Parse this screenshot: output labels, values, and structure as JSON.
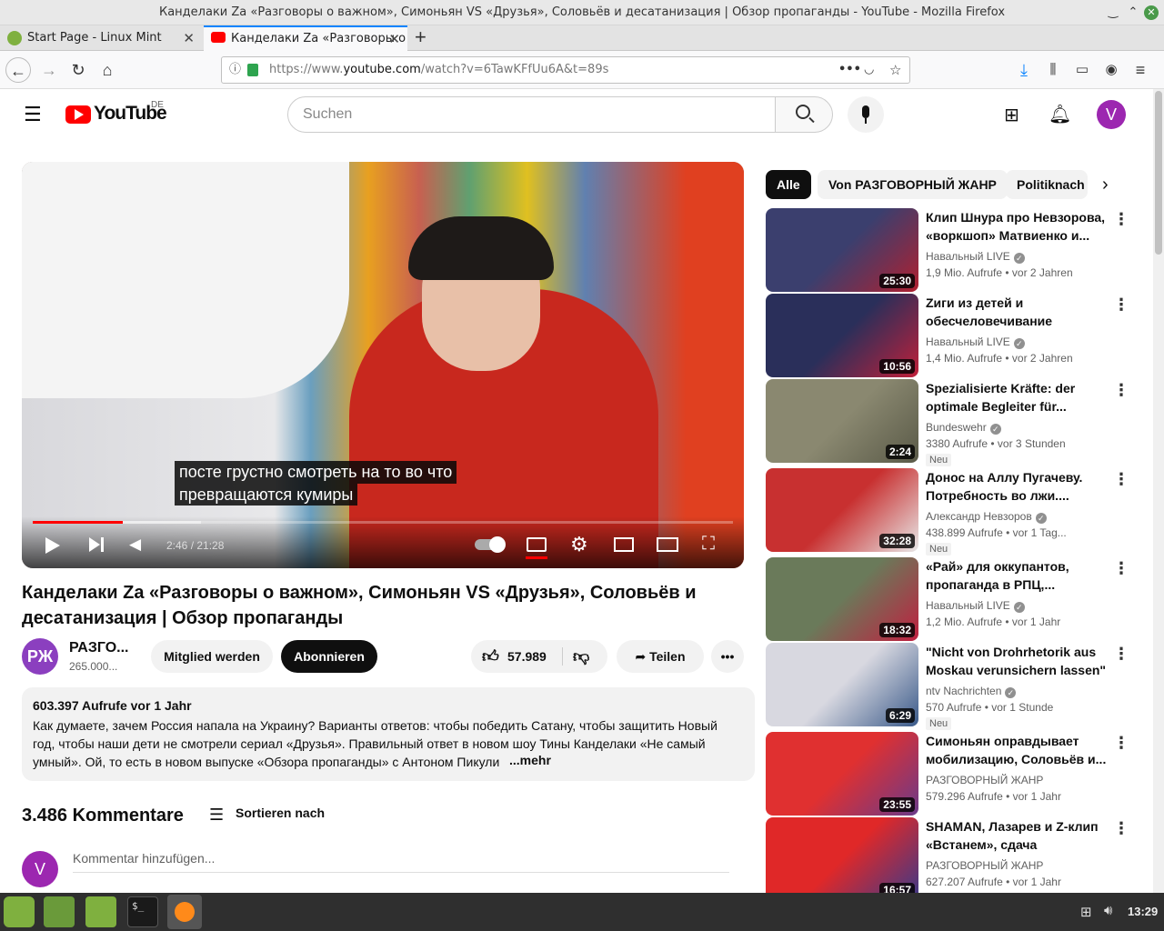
{
  "window": {
    "title": "Канделаки Za «Разговоры о важном», Симоньян VS «Друзья», Соловьёв и десатанизация | Обзор пропаганды - YouTube - Mozilla Firefox"
  },
  "tabs": [
    {
      "label": "Start Page - Linux Mint"
    },
    {
      "label": "Канделаки Za «Разговоры о"
    }
  ],
  "url": {
    "prefix": "https://www.",
    "domain": "youtube.com",
    "path": "/watch?v=6TawKFfUu6A&t=89s"
  },
  "yt": {
    "logo": "YouTube",
    "region": "DE",
    "search_placeholder": "Suchen",
    "avatar_letter": "V"
  },
  "video": {
    "subtitle_line1": "посте грустно смотреть на то во что",
    "subtitle_line2": "превращаются кумиры",
    "time": "2:46 / 21:28",
    "progress": 0.129,
    "buffered": 0.24,
    "title": "Канделаки Za «Разговоры о важном», Симоньян VS «Друзья», Соловьёв и десатанизация | Обзор пропаганды",
    "channel": "РАЗГО...",
    "subs": "265.000...",
    "join": "Mitglied werden",
    "subscribe": "Abonnieren",
    "likes": "57.989",
    "share": "Teilen",
    "views": "603.397 Aufrufe  vor 1 Jahr",
    "description": "Как думаете, зачем Россия напала на Украину? Варианты ответов: чтобы победить Сатану, чтобы защитить Новый год, чтобы наши дети не смотрели сериал «Друзья». Правильный ответ в новом шоу Тины Канделаки «Не самый умный». Ой, то есть в новом выпуске «Обзора пропаганды» с Антоном Пикули",
    "more": "...mehr"
  },
  "comments": {
    "count": "3.486 Kommentare",
    "sort": "Sortieren nach",
    "placeholder": "Kommentar hinzufügen..."
  },
  "chips": [
    "Alle",
    "Von РАЗГОВОРНЫЙ ЖАНР",
    "Politiknach"
  ],
  "recommendations": [
    {
      "title": "Клип Шнура про Невзорова, «воркшоп» Матвиенко и...",
      "channel": "Навальный LIVE",
      "verified": true,
      "meta": "1,9 Mio. Aufrufe  • vor 2 Jahren",
      "duration": "25:30",
      "badge": "",
      "colors": [
        "#3b3f6e",
        "#b02030"
      ]
    },
    {
      "title": "Zиги из детей и обесчеловечивание Украин...",
      "channel": "Навальный LIVE",
      "verified": true,
      "meta": "1,4 Mio. Aufrufe  • vor 2 Jahren",
      "duration": "10:56",
      "badge": "",
      "colors": [
        "#2a2f5a",
        "#c0203a"
      ]
    },
    {
      "title": "Spezialisierte Kräfte: der optimale Begleiter für...",
      "channel": "Bundeswehr",
      "verified": true,
      "meta": "3380 Aufrufe  • vor 3 Stunden",
      "duration": "2:24",
      "badge": "Neu",
      "colors": [
        "#8a8870",
        "#5a5a48"
      ]
    },
    {
      "title": "Донос на Аллу Пугачеву. Потребность во лжи....",
      "channel": "Александр Невзоров",
      "verified": true,
      "meta": "438.899 Aufrufe  • vor 1 Tag...",
      "duration": "32:28",
      "badge": "Neu",
      "colors": [
        "#c83030",
        "#e8e8e8"
      ]
    },
    {
      "title": "«Рай» для оккупантов, пропаганда в РПЦ,...",
      "channel": "Навальный LIVE",
      "verified": true,
      "meta": "1,2 Mio. Aufrufe  • vor 1 Jahr",
      "duration": "18:32",
      "badge": "",
      "colors": [
        "#6a7a5a",
        "#c02040"
      ]
    },
    {
      "title": "\"Nicht von Drohrhetorik aus Moskau verunsichern lassen\" ...",
      "channel": "ntv Nachrichten",
      "verified": true,
      "meta": "570 Aufrufe  • vor 1 Stunde",
      "duration": "6:29",
      "badge": "Neu",
      "colors": [
        "#d8d8e0",
        "#3a5a8a"
      ]
    },
    {
      "title": "Симоньян оправдывает мобилизацию, Соловьёв и...",
      "channel": "РАЗГОВОРНЫЙ ЖАНР",
      "verified": false,
      "meta": "579.296 Aufrufe  • vor 1 Jahr",
      "duration": "23:55",
      "badge": "",
      "colors": [
        "#e03030",
        "#6a3a8a"
      ]
    },
    {
      "title": "SHAMAN, Лазарев и Z-клип «Встанем», сдача Херсона,...",
      "channel": "РАЗГОВОРНЫЙ ЖАНР",
      "verified": false,
      "meta": "627.207 Aufrufe  • vor 1 Jahr",
      "duration": "16:57",
      "badge": "",
      "colors": [
        "#e02828",
        "#3a3a8a"
      ]
    }
  ],
  "taskbar": {
    "time": "13:29"
  }
}
